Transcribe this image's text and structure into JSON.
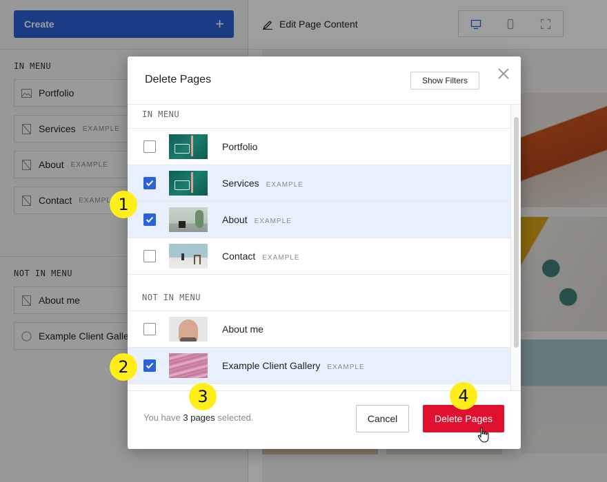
{
  "sidebar": {
    "create_label": "Create",
    "in_menu_heading": "IN MENU",
    "not_in_menu_heading": "NOT IN MENU",
    "in_menu_items": [
      {
        "label": "Portfolio",
        "tag": "",
        "icon": "image-page-icon"
      },
      {
        "label": "Services",
        "tag": "EXAMPLE",
        "icon": "page-icon"
      },
      {
        "label": "About",
        "tag": "EXAMPLE",
        "icon": "page-icon"
      },
      {
        "label": "Contact",
        "tag": "EXAMPLE",
        "icon": "page-icon"
      }
    ],
    "not_in_menu_items": [
      {
        "label": "About me",
        "tag": "",
        "icon": "page-icon"
      },
      {
        "label": "Example Client Galler",
        "tag": "",
        "icon": "gallery-icon"
      }
    ]
  },
  "topbar": {
    "edit_label": "Edit Page Content",
    "devices": [
      "desktop-icon",
      "mobile-icon",
      "fullscreen-icon"
    ]
  },
  "modal": {
    "title": "Delete Pages",
    "show_filters_label": "Show Filters",
    "in_menu_heading": "IN MENU",
    "not_in_menu_heading": "NOT IN MENU",
    "in_menu_rows": [
      {
        "label": "Portfolio",
        "tag": "",
        "checked": false
      },
      {
        "label": "Services",
        "tag": "EXAMPLE",
        "checked": true
      },
      {
        "label": "About",
        "tag": "EXAMPLE",
        "checked": true
      },
      {
        "label": "Contact",
        "tag": "EXAMPLE",
        "checked": false
      }
    ],
    "not_in_menu_rows": [
      {
        "label": "About me",
        "tag": "",
        "checked": false
      },
      {
        "label": "Example Client Gallery",
        "tag": "EXAMPLE",
        "checked": true
      }
    ],
    "footer_prefix": "You have",
    "footer_count": "3 pages",
    "footer_suffix": "selected.",
    "cancel_label": "Cancel",
    "delete_label": "Delete Pages"
  },
  "badges": [
    "1",
    "2",
    "3",
    "4"
  ],
  "colors": {
    "accent": "#2d62d6",
    "danger": "#e0102f",
    "badge": "#ffee1a",
    "selected_row": "#e9f0fd"
  }
}
